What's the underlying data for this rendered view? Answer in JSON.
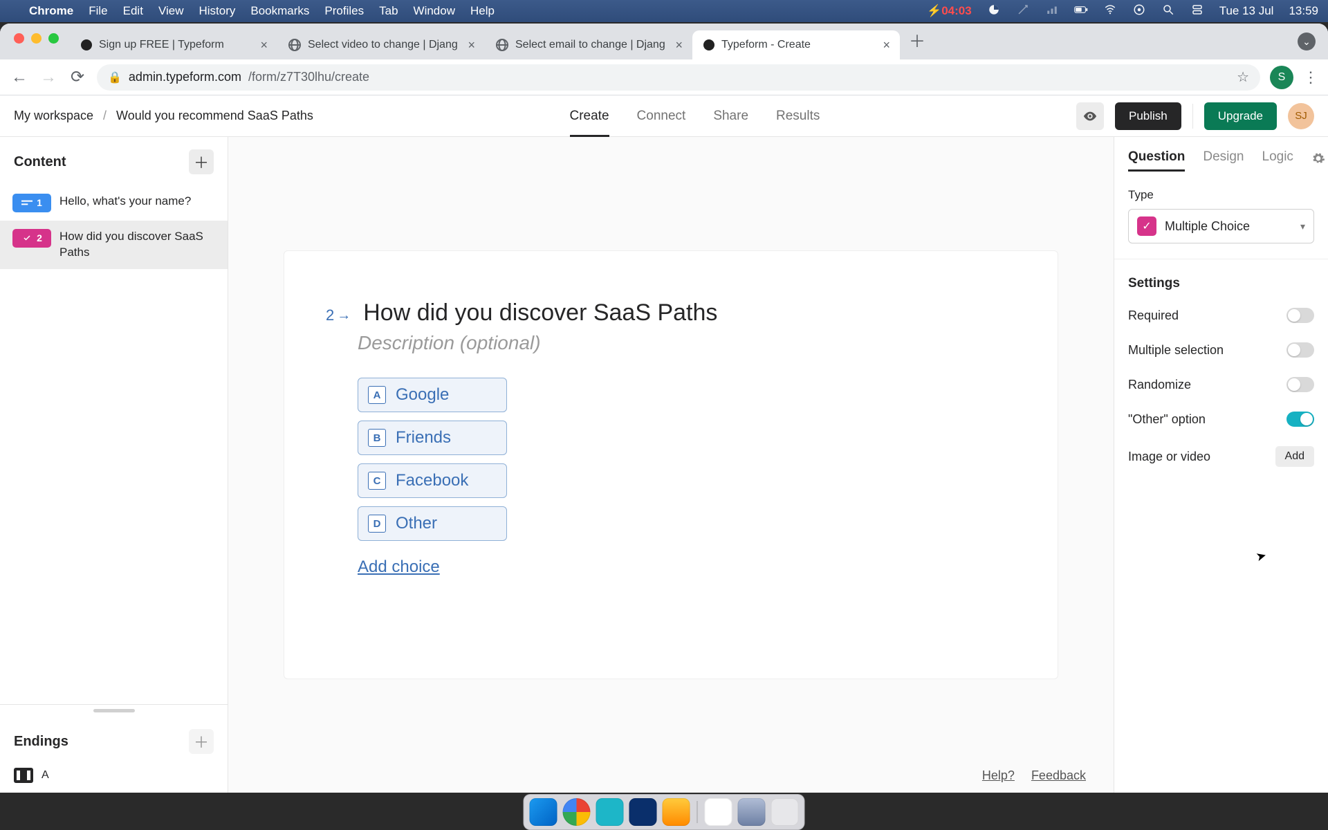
{
  "mac": {
    "app": "Chrome",
    "menus": [
      "File",
      "Edit",
      "View",
      "History",
      "Bookmarks",
      "Profiles",
      "Tab",
      "Window",
      "Help"
    ],
    "battery_timer": "04:03",
    "date": "Tue 13 Jul",
    "clock": "13:59"
  },
  "browser": {
    "tabs": [
      {
        "title": "Sign up FREE | Typeform",
        "fav": "dot"
      },
      {
        "title": "Select video to change | Djang",
        "fav": "globe"
      },
      {
        "title": "Select email to change | Djang",
        "fav": "globe"
      },
      {
        "title": "Typeform - Create",
        "fav": "dot",
        "active": true
      }
    ],
    "url_domain": "admin.typeform.com",
    "url_path": "/form/z7T30lhu/create",
    "profile_initial": "S"
  },
  "header": {
    "workspace": "My workspace",
    "form_name": "Would you recommend SaaS Paths",
    "tabs": [
      "Create",
      "Connect",
      "Share",
      "Results"
    ],
    "active_tab": "Create",
    "publish": "Publish",
    "upgrade": "Upgrade",
    "avatar": "SJ"
  },
  "sidebar": {
    "content_label": "Content",
    "items": [
      {
        "num": "1",
        "color": "blue",
        "title": "Hello, what's your name?"
      },
      {
        "num": "2",
        "color": "pink",
        "title": "How did you discover SaaS Paths",
        "active": true
      }
    ],
    "endings_label": "Endings",
    "ending_letter": "A"
  },
  "canvas": {
    "num": "2",
    "title": "How did you discover SaaS Paths",
    "description_placeholder": "Description (optional)",
    "choices": [
      {
        "key": "A",
        "label": "Google"
      },
      {
        "key": "B",
        "label": "Friends"
      },
      {
        "key": "C",
        "label": "Facebook"
      },
      {
        "key": "D",
        "label": "Other"
      }
    ],
    "add_choice": "Add choice",
    "help": "Help?",
    "feedback": "Feedback"
  },
  "right": {
    "tabs": [
      "Question",
      "Design",
      "Logic"
    ],
    "active_tab": "Question",
    "type_label": "Type",
    "type_value": "Multiple Choice",
    "settings_label": "Settings",
    "settings": [
      {
        "label": "Required",
        "on": false
      },
      {
        "label": "Multiple selection",
        "on": false
      },
      {
        "label": "Randomize",
        "on": false
      },
      {
        "label": "\"Other\" option",
        "on": true
      }
    ],
    "media_label": "Image or video",
    "media_button": "Add"
  }
}
